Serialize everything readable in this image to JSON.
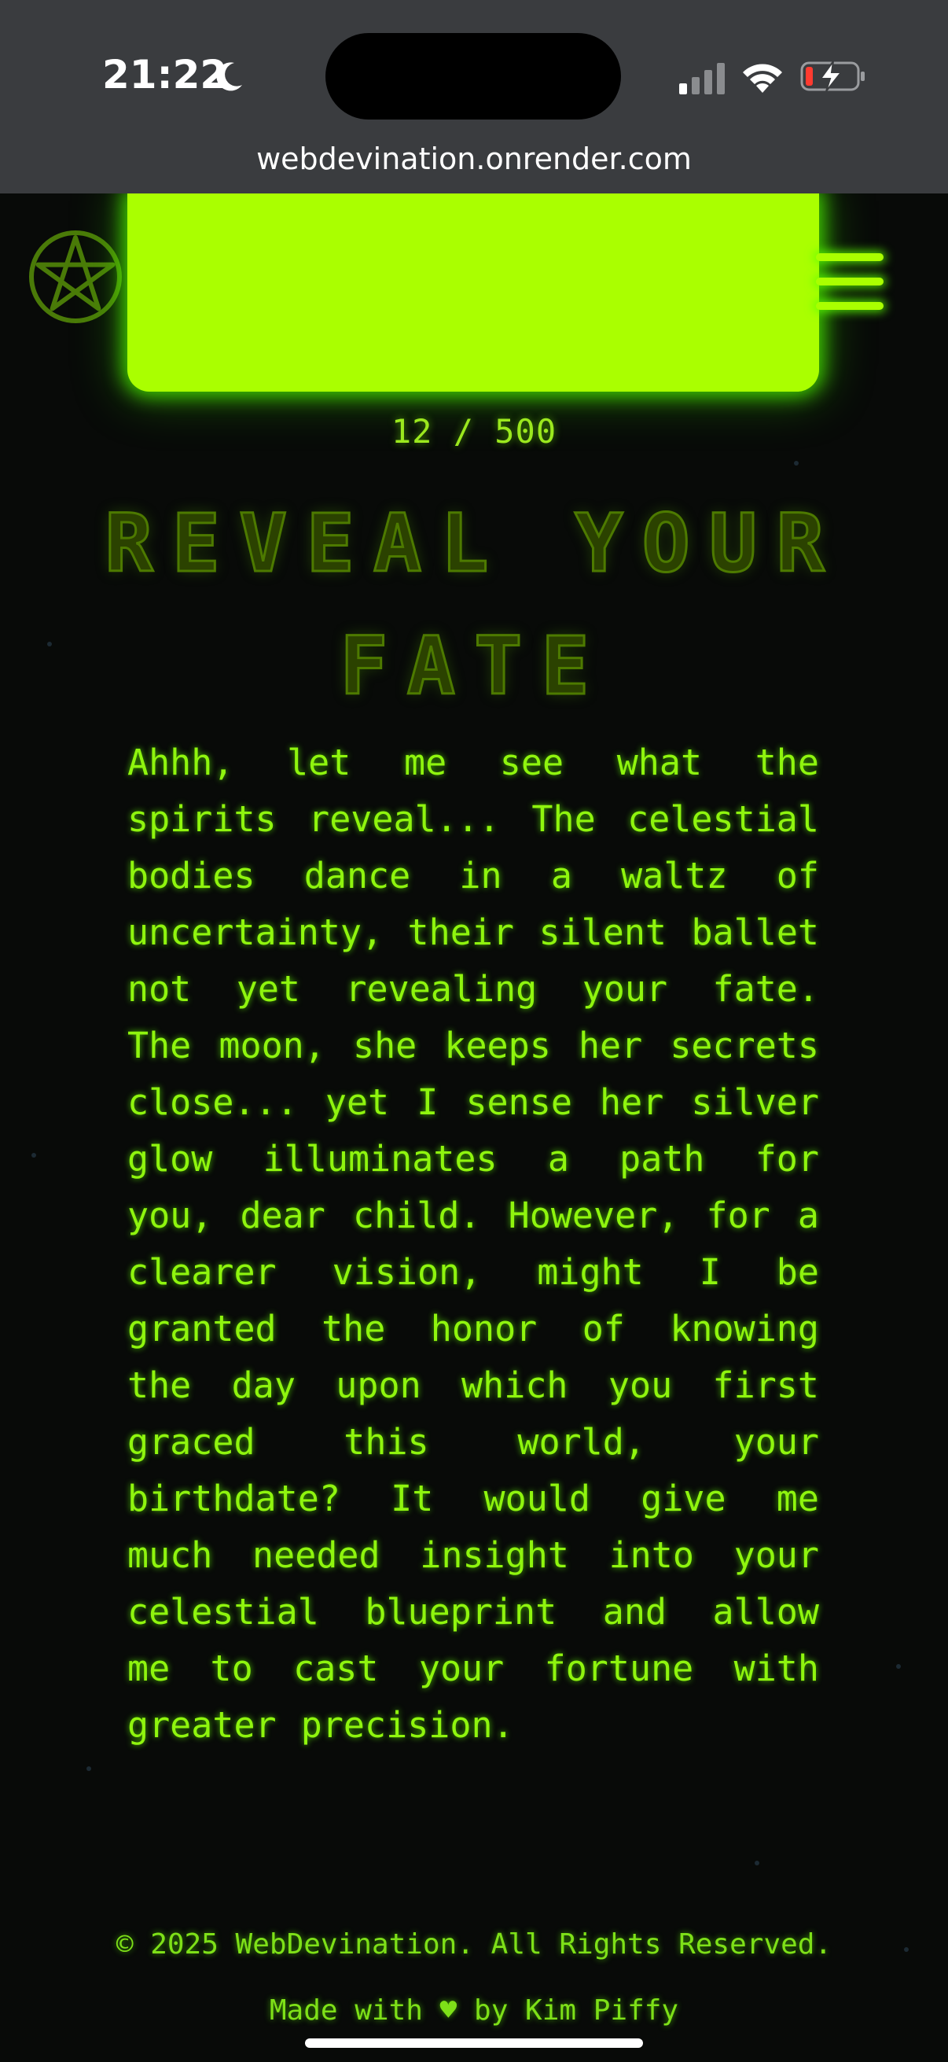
{
  "status_bar": {
    "time": "21:22",
    "moon_icon": "moon-icon",
    "signal_icon": "cellular-signal-icon",
    "wifi_icon": "wifi-icon",
    "battery_icon": "battery-charging-icon",
    "battery_level": 0.15
  },
  "browser": {
    "url": "webdevination.onrender.com"
  },
  "header": {
    "logo_icon": "pentagram-icon",
    "menu_icon": "hamburger-menu-icon",
    "banner_color": "#aaff00"
  },
  "counter": "12 / 500",
  "title": "REVEAL YOUR FATE",
  "message": "Ahhh, let me see what the spirits reveal... The celestial bodies dance in a waltz of uncertainty, their silent ballet not yet revealing your fate. The moon, she keeps her secrets close... yet I sense her silver glow illuminates a path for you, dear child. However, for a clearer vision, might I be granted the honor of knowing the day upon which you first graced this world, your birthdate? It would give me much needed insight into your celestial blueprint and allow me to cast your fortune with greater precision.",
  "footer": {
    "copyright": "© 2025 WebDevination. All Rights Reserved.",
    "made_with_prefix": "Made with",
    "heart": "♥",
    "made_with_suffix": "by Kim Piffy"
  },
  "colors": {
    "accent": "#aaff00",
    "text_glow": "#8ff50e",
    "background": "#080a08"
  }
}
